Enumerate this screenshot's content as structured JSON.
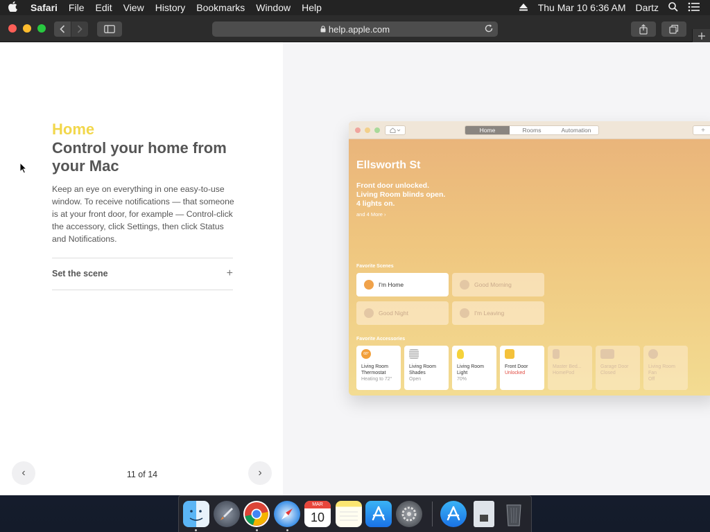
{
  "menubar": {
    "app_name": "Safari",
    "items": [
      "File",
      "Edit",
      "View",
      "History",
      "Bookmarks",
      "Window",
      "Help"
    ],
    "datetime": "Thu Mar 10  6:36 AM",
    "user": "Dartz"
  },
  "browser": {
    "url": "help.apple.com"
  },
  "article": {
    "eyebrow": "Home",
    "headline": "Control your home from your Mac",
    "body": "Keep an eye on everything in one easy-to-use window. To receive notifications — that someone is at your front door, for example — Control-click the accessory, click Settings, then click Status and Notifications.",
    "expandable_label": "Set the scene",
    "expand_glyph": "+"
  },
  "pager": {
    "text": "11 of 14",
    "prev_glyph": "‹",
    "next_glyph": "›"
  },
  "home_app": {
    "tabs": [
      "Home",
      "Rooms",
      "Automation"
    ],
    "active_tab": "Home",
    "add_glyph": "+",
    "home_name": "Ellsworth St",
    "status_lines": [
      "Front door unlocked.",
      "Living Room blinds open.",
      "4 lights on."
    ],
    "more_link": "and 4 More ›",
    "scenes_header": "Favorite Scenes",
    "scenes": [
      "I'm Home",
      "Good Morning",
      "Good Night",
      "I'm Leaving"
    ],
    "accessories_header": "Favorite Accessories",
    "accessories": [
      {
        "name": "Living Room Thermostat",
        "state": "Heating to 72°",
        "icon_label": "68°"
      },
      {
        "name": "Living Room Shades",
        "state": "Open"
      },
      {
        "name": "Living Room Light",
        "state": "70%"
      },
      {
        "name": "Front Door",
        "state": "Unlocked"
      },
      {
        "name": "Master Bed... HomePod",
        "state": ""
      },
      {
        "name": "Garage Door",
        "state": "Closed"
      },
      {
        "name": "Living Room Fan",
        "state": "Off"
      }
    ]
  },
  "dock": {
    "calendar_month": "MAR",
    "calendar_day": "10"
  }
}
